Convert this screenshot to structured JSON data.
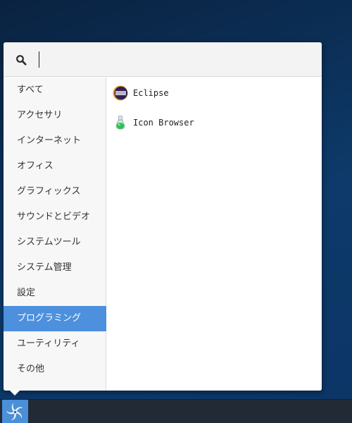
{
  "search": {
    "placeholder": "",
    "value": "",
    "icon": "search-icon"
  },
  "categories": [
    {
      "label": "すべて"
    },
    {
      "label": "アクセサリ"
    },
    {
      "label": "インターネット"
    },
    {
      "label": "オフィス"
    },
    {
      "label": "グラフィックス"
    },
    {
      "label": "サウンドとビデオ"
    },
    {
      "label": "システムツール"
    },
    {
      "label": "システム管理"
    },
    {
      "label": "設定"
    },
    {
      "label": "プログラミング",
      "selected": true
    },
    {
      "label": "ユーティリティ"
    },
    {
      "label": "その他"
    }
  ],
  "apps": [
    {
      "label": "Eclipse",
      "icon": "eclipse-icon"
    },
    {
      "label": "Icon Browser",
      "icon": "icon-browser-icon"
    }
  ],
  "taskbar": {
    "start_icon": "start-menu-icon"
  },
  "colors": {
    "selection": "#4d90dd",
    "taskbar": "#222a35",
    "start_button": "#4a8fd8",
    "desktop": "#0d3a6a"
  }
}
